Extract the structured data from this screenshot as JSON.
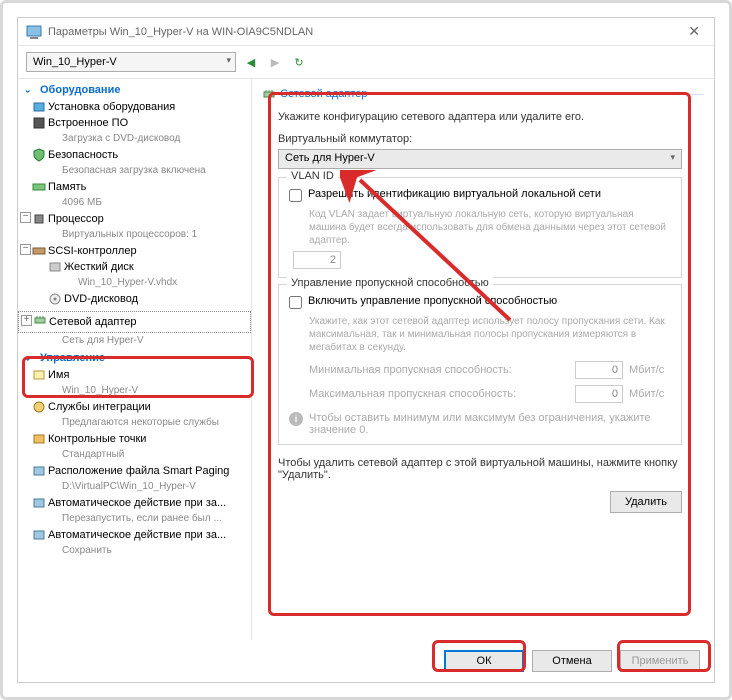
{
  "window": {
    "title": "Параметры Win_10_Hyper-V на WIN-OIA9C5NDLAN"
  },
  "toolbar": {
    "vm_name": "Win_10_Hyper-V"
  },
  "sidebar": {
    "section_hardware": "Оборудование",
    "items_hw": [
      {
        "label": "Установка оборудования",
        "sub": ""
      },
      {
        "label": "Встроенное ПО",
        "sub": "Загрузка с DVD-дисковод"
      },
      {
        "label": "Безопасность",
        "sub": "Безопасная загрузка включена"
      },
      {
        "label": "Память",
        "sub": "4096 МБ"
      },
      {
        "label": "Процессор",
        "sub": "Виртуальных процессоров: 1"
      },
      {
        "label": "SCSI-контроллер",
        "sub": ""
      }
    ],
    "scsi_children": [
      {
        "label": "Жесткий диск",
        "sub": "Win_10_Hyper-V.vhdx"
      },
      {
        "label": "DVD-дисковод",
        "sub": ""
      }
    ],
    "network_adapter": {
      "label": "Сетевой адаптер",
      "sub": "Сеть для Hyper-V"
    },
    "section_management": "Управление",
    "items_mgmt": [
      {
        "label": "Имя",
        "sub": "Win_10_Hyper-V"
      },
      {
        "label": "Службы интеграции",
        "sub": "Предлагаются некоторые службы"
      },
      {
        "label": "Контрольные точки",
        "sub": "Стандартный"
      },
      {
        "label": "Расположение файла Smart Paging",
        "sub": "D:\\VirtualPC\\Win_10_Hyper-V"
      },
      {
        "label": "Автоматическое действие при за...",
        "sub": "Перезапустить, если ранее был ..."
      },
      {
        "label": "Автоматическое действие при за...",
        "sub": "Сохранить"
      }
    ]
  },
  "content": {
    "header": "Сетевой адаптер",
    "desc": "Укажите конфигурацию сетевого адаптера или удалите его.",
    "switch_label": "Виртуальный коммутатор:",
    "switch_value": "Сеть для Hyper-V",
    "vlan": {
      "legend": "VLAN ID",
      "checkbox": "Разрешить идентификацию виртуальной локальной сети",
      "hint": "Код VLAN задает виртуальную локальную сеть, которую виртуальная машина будет всегда использовать для обмена данными через этот сетевой адаптер.",
      "value": "2"
    },
    "bw": {
      "legend": "Управление пропускной способностью",
      "checkbox": "Включить управление пропускной способностью",
      "hint": "Укажите, как этот сетевой адаптер использует полосу пропускания сети. Как максимальная, так и минимальная полосы пропускания измеряются в мегабитах в секунду.",
      "min_label": "Минимальная пропускная способность:",
      "min_value": "0",
      "max_label": "Максимальная пропускная способность:",
      "max_value": "0",
      "unit": "Мбит/с",
      "info": "Чтобы оставить минимум или максимум без ограничения, укажите значение 0."
    },
    "delete_text": "Чтобы удалить сетевой адаптер с этой виртуальной машины, нажмите кнопку \"Удалить\".",
    "delete_btn": "Удалить"
  },
  "footer": {
    "ok": "ОК",
    "cancel": "Отмена",
    "apply": "Применить"
  }
}
